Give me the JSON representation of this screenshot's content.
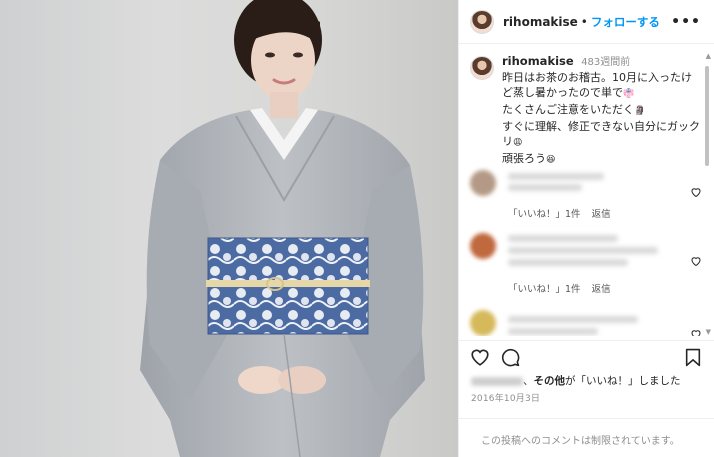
{
  "post": {
    "username": "rihomakise",
    "separator": "•",
    "follow_label": "フォローする",
    "more_label": "•••"
  },
  "caption": {
    "username": "rihomakise",
    "time_ago": "483週間前",
    "lines": [
      "昨日はお茶のお稽古。10月に入ったけ",
      "ど蒸し暑かったので単で",
      "たくさんご注意をいただく",
      "すぐに理解、修正できない自分にガック",
      "リ",
      "頑張ろう"
    ]
  },
  "comments": [
    {
      "like_count": "「いいね！」1件",
      "reply_label": "返信"
    },
    {
      "like_count": "「いいね！」1件",
      "reply_label": "返信"
    }
  ],
  "likes_line": {
    "separator": "、",
    "others": "その他",
    "suffix": "が「いいね！」しました"
  },
  "date": "2016年10月3日",
  "comments_restricted": "この投稿へのコメントは制限されています。",
  "icons": {
    "avatar": "profile-photo",
    "heart": "heart-icon",
    "comment": "comment-icon",
    "bookmark": "bookmark-icon",
    "more": "more-icon"
  },
  "colors": {
    "accent": "#0095f6",
    "muted_text": "#8e8e8e",
    "kimono": "#b9bdc2",
    "obi": "#4e6ea6"
  }
}
